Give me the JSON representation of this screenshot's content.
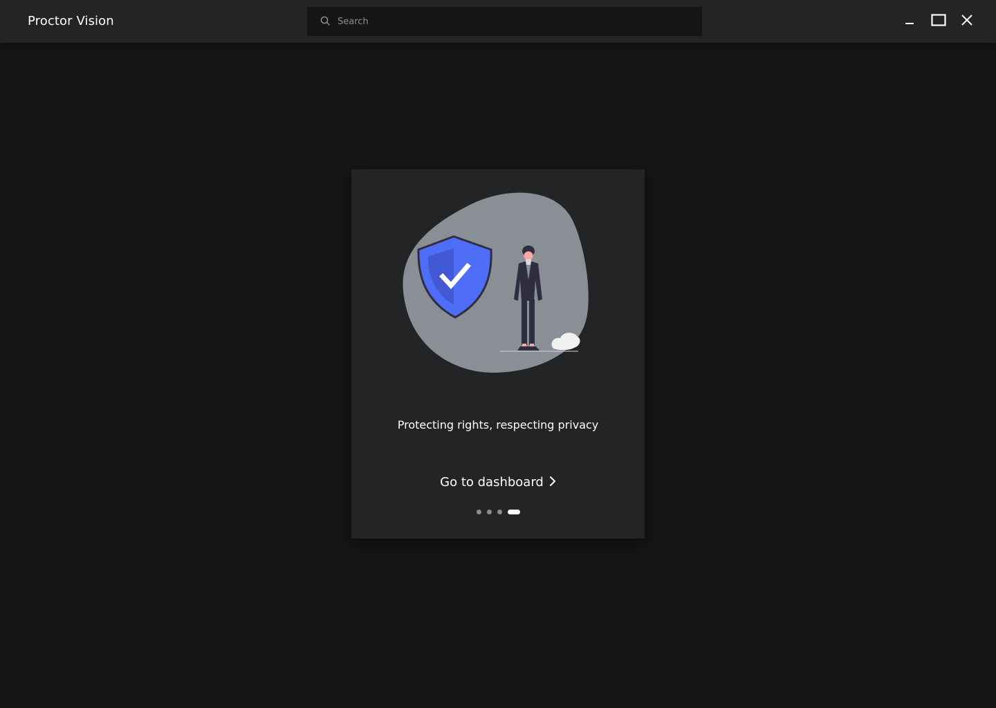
{
  "app": {
    "title": "Proctor Vision"
  },
  "search": {
    "placeholder": "Search",
    "value": "",
    "icon": "search-icon"
  },
  "window_controls": {
    "minimize_icon": "minimize-icon",
    "maximize_icon": "maximize-icon",
    "close_icon": "close-icon"
  },
  "onboarding": {
    "illustration": "security-shield-person-illustration",
    "tagline": "Protecting rights, respecting privacy",
    "cta_label": "Go to dashboard",
    "cta_icon": "chevron-right-icon",
    "pager": {
      "total": 4,
      "active_index": 3
    }
  },
  "colors": {
    "background": "#141517",
    "titlebar": "#232426",
    "card": "#232426",
    "blob": "#8a8f96",
    "shield": "#4f6ef7",
    "accent_dark": "#2f2e41"
  }
}
